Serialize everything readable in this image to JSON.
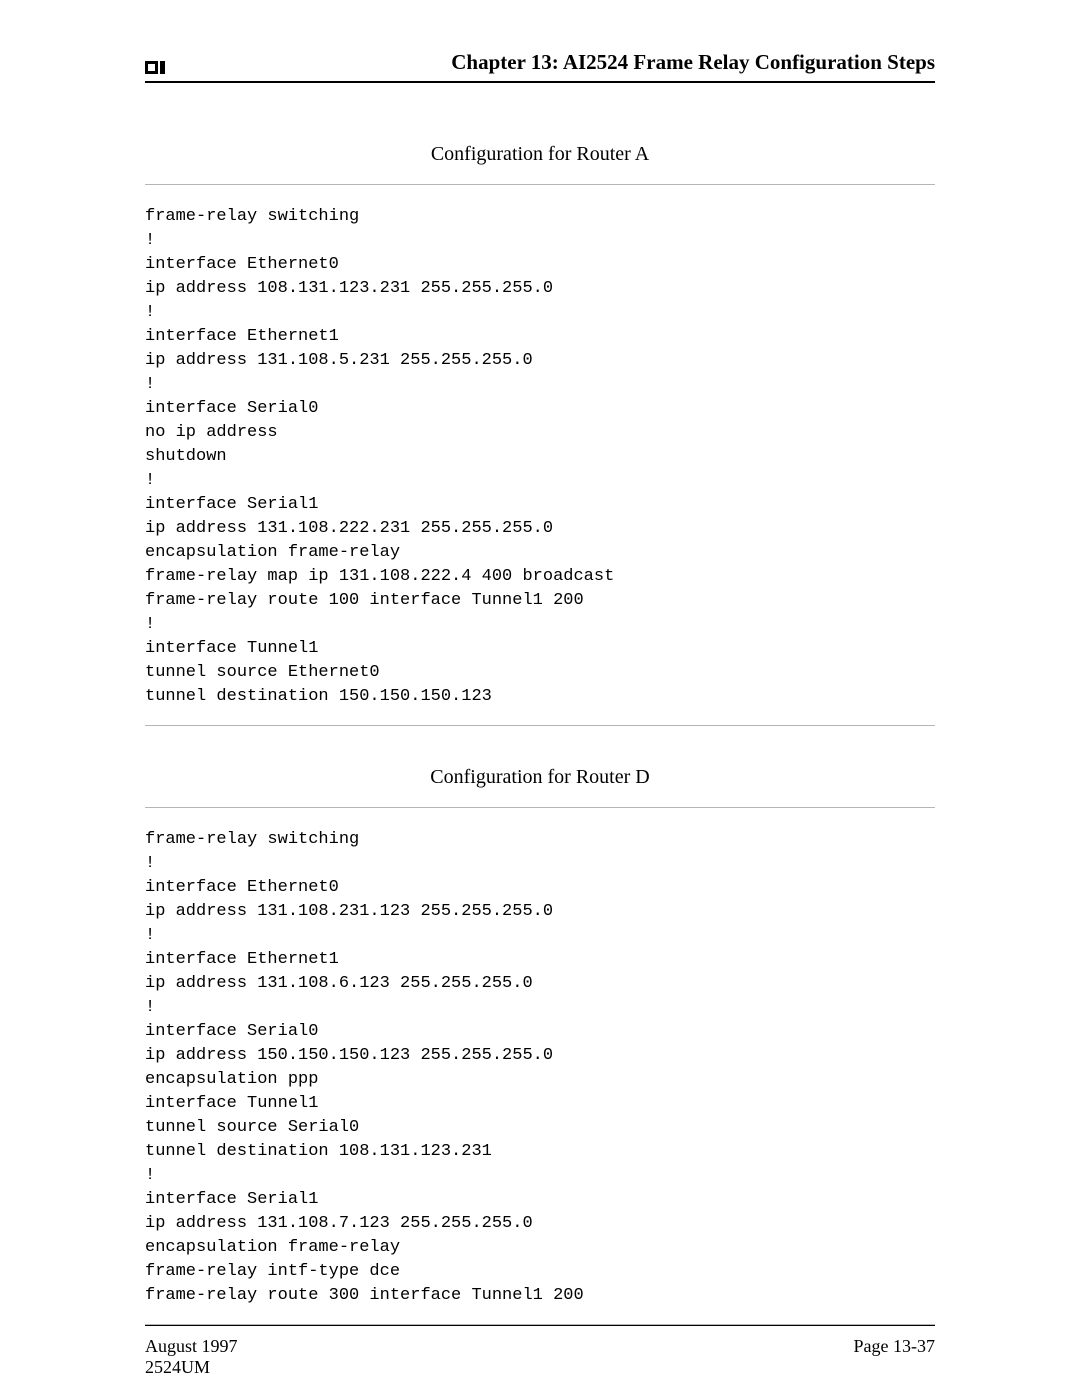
{
  "header": {
    "chapter_title": "Chapter 13: AI2524 Frame Relay Configuration Steps"
  },
  "sections": {
    "a": {
      "title": "Configuration for Router A",
      "code": "frame-relay switching\n!\ninterface Ethernet0\nip address 108.131.123.231 255.255.255.0\n!\ninterface Ethernet1\nip address 131.108.5.231 255.255.255.0\n!\ninterface Serial0\nno ip address\nshutdown\n!\ninterface Serial1\nip address 131.108.222.231 255.255.255.0\nencapsulation frame-relay\nframe-relay map ip 131.108.222.4 400 broadcast\nframe-relay route 100 interface Tunnel1 200\n!\ninterface Tunnel1\ntunnel source Ethernet0\ntunnel destination 150.150.150.123"
    },
    "d": {
      "title": "Configuration for Router D",
      "code": "frame-relay switching\n!\ninterface Ethernet0\nip address 131.108.231.123 255.255.255.0\n!\ninterface Ethernet1\nip address 131.108.6.123 255.255.255.0\n!\ninterface Serial0\nip address 150.150.150.123 255.255.255.0\nencapsulation ppp\ninterface Tunnel1\ntunnel source Serial0\ntunnel destination 108.131.123.231\n!\ninterface Serial1\nip address 131.108.7.123 255.255.255.0\nencapsulation frame-relay\nframe-relay intf-type dce\nframe-relay route 300 interface Tunnel1 200"
    }
  },
  "footer": {
    "date": "August 1997",
    "doc_id": "2524UM",
    "page": "Page 13-37"
  }
}
